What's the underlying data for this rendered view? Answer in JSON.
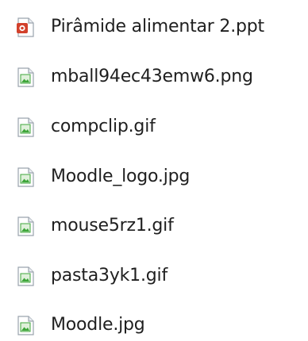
{
  "files": [
    {
      "name": "Pirâmide alimentar 2.ppt",
      "icon": "powerpoint-file-icon"
    },
    {
      "name": "mball94ec43emw6.png",
      "icon": "image-file-icon"
    },
    {
      "name": "compclip.gif",
      "icon": "image-file-icon"
    },
    {
      "name": "Moodle_logo.jpg",
      "icon": "image-file-icon"
    },
    {
      "name": "mouse5rz1.gif",
      "icon": "image-file-icon"
    },
    {
      "name": "pasta3yk1.gif",
      "icon": "image-file-icon"
    },
    {
      "name": "Moodle.jpg",
      "icon": "image-file-icon"
    }
  ],
  "colors": {
    "powerpoint_red": "#d2412c",
    "image_green": "#3ea63a",
    "icon_border": "#9aa3ad",
    "text": "#1f1f1f"
  }
}
